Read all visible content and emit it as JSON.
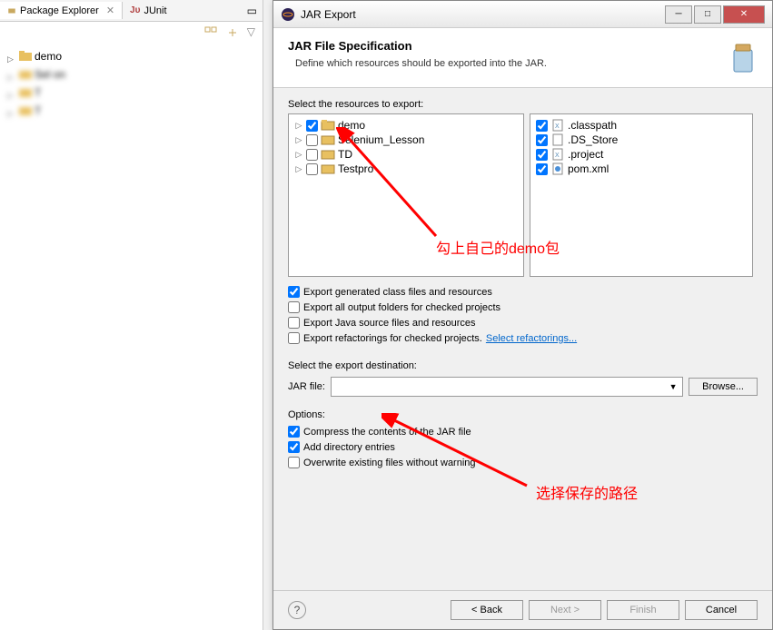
{
  "explorer": {
    "tabs": [
      {
        "label": "Package Explorer",
        "active": true
      },
      {
        "label": "JUnit",
        "active": false
      }
    ],
    "items": [
      {
        "label": "demo"
      },
      {
        "label": "Sel            on"
      },
      {
        "label": "T"
      },
      {
        "label": "T"
      }
    ]
  },
  "dialog": {
    "title": "JAR Export",
    "header_title": "JAR File Specification",
    "header_subtitle": "Define which resources should be exported into the JAR.",
    "select_resources_label": "Select the resources to export:",
    "left_resources": [
      {
        "label": "demo",
        "checked": true
      },
      {
        "label": "Selenium_Lesson",
        "checked": false
      },
      {
        "label": "TD",
        "checked": false
      },
      {
        "label": "Testpro",
        "checked": false
      }
    ],
    "right_resources": [
      {
        "label": ".classpath",
        "checked": true
      },
      {
        "label": ".DS_Store",
        "checked": true
      },
      {
        "label": ".project",
        "checked": true
      },
      {
        "label": "pom.xml",
        "checked": true
      }
    ],
    "export_options": [
      {
        "label": "Export generated class files and resources",
        "checked": true
      },
      {
        "label": "Export all output folders for checked projects",
        "checked": false
      },
      {
        "label": "Export Java source files and resources",
        "checked": false
      },
      {
        "label": "Export refactorings for checked projects.",
        "checked": false,
        "link": "Select refactorings..."
      }
    ],
    "destination_label": "Select the export destination:",
    "jar_file_label": "JAR file:",
    "jar_file_value": "",
    "browse_label": "Browse...",
    "options_label": "Options:",
    "options": [
      {
        "label": "Compress the contents of the JAR file",
        "checked": true
      },
      {
        "label": "Add directory entries",
        "checked": true
      },
      {
        "label": "Overwrite existing files without warning",
        "checked": false
      }
    ],
    "buttons": {
      "back": "< Back",
      "next": "Next >",
      "finish": "Finish",
      "cancel": "Cancel"
    }
  },
  "annotations": {
    "demo_note": "勾上自己的demo包",
    "path_note": "选择保存的路径"
  }
}
